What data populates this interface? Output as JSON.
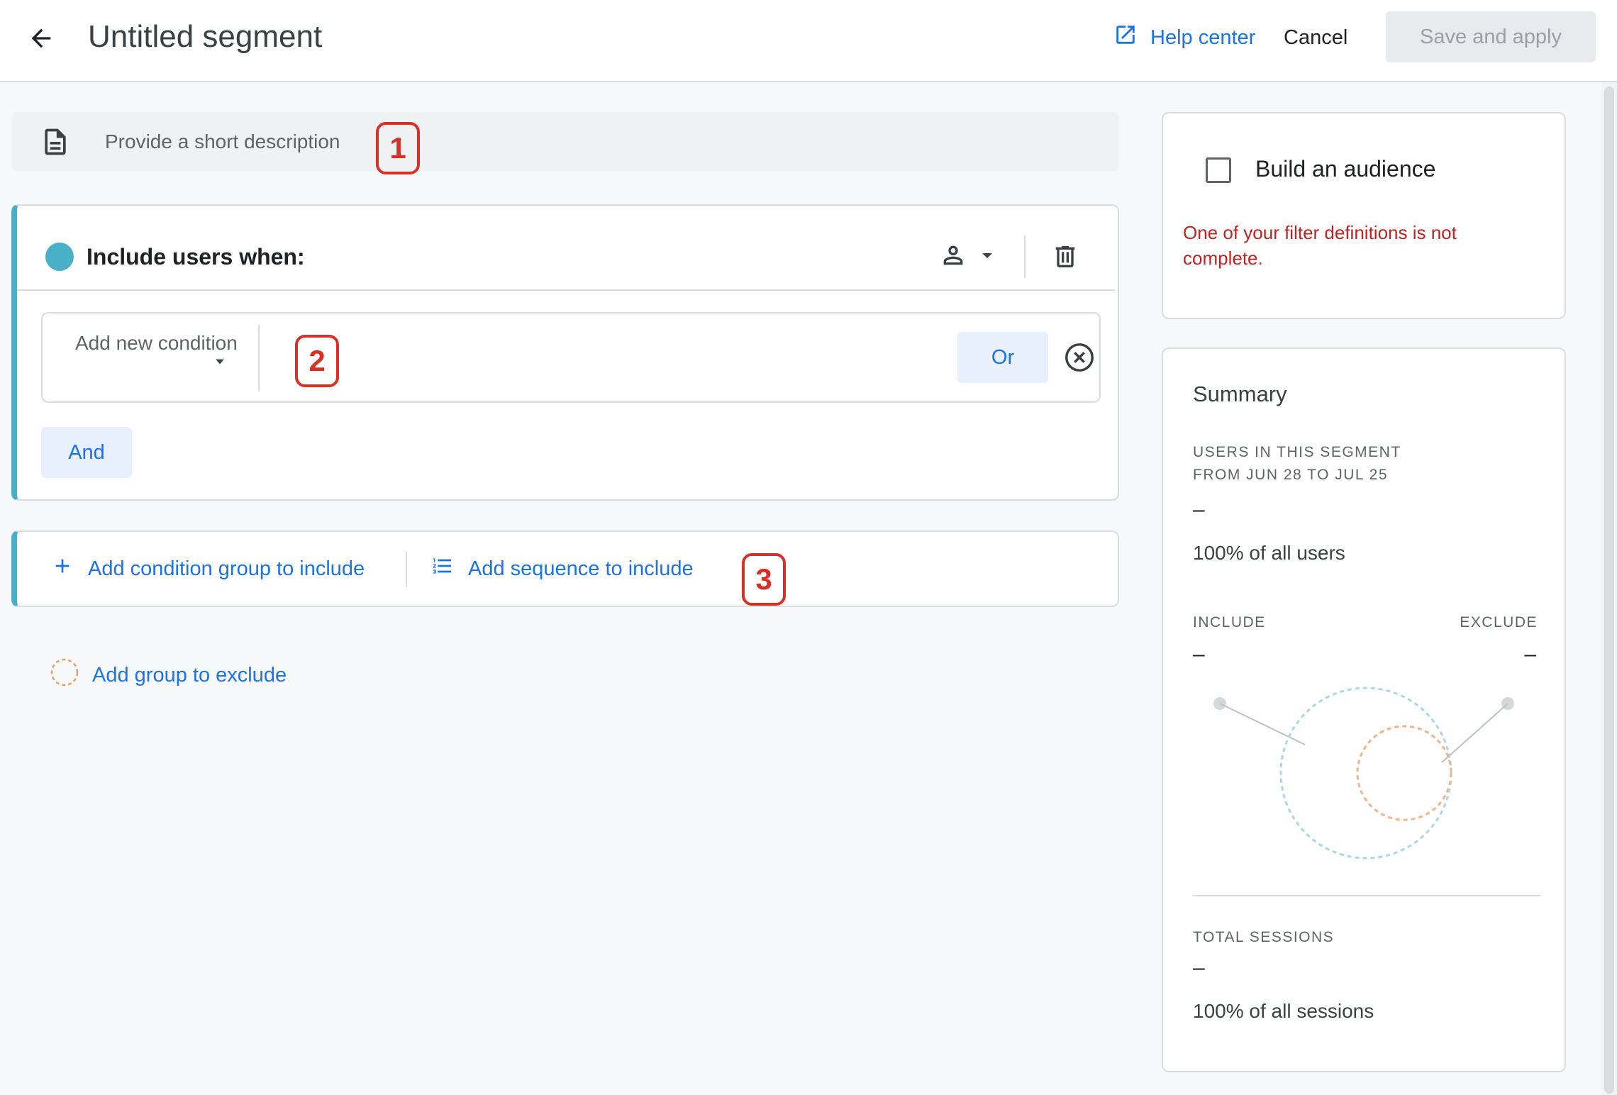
{
  "header": {
    "title": "Untitled segment",
    "help_label": "Help center",
    "cancel_label": "Cancel",
    "save_label": "Save and apply"
  },
  "description": {
    "placeholder": "Provide a short description"
  },
  "callouts": [
    "1",
    "2",
    "3"
  ],
  "include_group": {
    "title": "Include users when:",
    "condition_placeholder": "Add new condition",
    "or_label": "Or",
    "and_label": "And"
  },
  "add_groups": {
    "condition_group_label": "Add condition group to include",
    "sequence_label": "Add sequence to include",
    "exclude_label": "Add group to exclude"
  },
  "audience": {
    "label": "Build an audience",
    "checked": false,
    "error": "One of your filter definitions is not complete."
  },
  "summary": {
    "heading": "Summary",
    "users_caption_line1": "USERS IN THIS SEGMENT",
    "users_caption_line2": "FROM JUN 28 TO JUL 25",
    "users_value": "–",
    "users_pct": "100% of all users",
    "include_label": "INCLUDE",
    "exclude_label": "EXCLUDE",
    "include_value": "–",
    "exclude_value": "–",
    "sessions_caption": "TOTAL SESSIONS",
    "sessions_value": "–",
    "sessions_pct": "100% of all sessions"
  },
  "colors": {
    "accent_blue": "#1a73e8",
    "include_teal": "#4ab0c8",
    "exclude_orange": "#e8a06a",
    "error_red": "#c5221f",
    "callout_red": "#d93025"
  }
}
